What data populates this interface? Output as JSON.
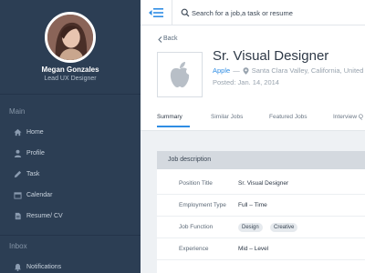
{
  "profile": {
    "name": "Megan Gonzales",
    "role": "Lead UX Designer"
  },
  "sidebar": {
    "main_label": "Main",
    "items": [
      {
        "label": "Home",
        "icon": "home-icon"
      },
      {
        "label": "Profile",
        "icon": "person-icon"
      },
      {
        "label": "Task",
        "icon": "pencil-icon"
      },
      {
        "label": "Calendar",
        "icon": "calendar-icon"
      },
      {
        "label": "Resume/ CV",
        "icon": "document-icon"
      }
    ],
    "inbox_label": "Inbox",
    "inbox_items": [
      {
        "label": "Notifications",
        "icon": "bell-icon"
      }
    ]
  },
  "search": {
    "placeholder": "Search for a job,a task or resume"
  },
  "job": {
    "back_label": "Back",
    "title": "Sr. Visual Designer",
    "company": "Apple",
    "dash": "—",
    "location": "Santa Clara Valley, California, United",
    "posted": "Posted: Jan. 14, 2014"
  },
  "tabs": [
    {
      "label": "Summary",
      "active": true
    },
    {
      "label": "Similar Jobs",
      "active": false
    },
    {
      "label": "Featured Jobs",
      "active": false
    },
    {
      "label": "Interview Q",
      "active": false
    }
  ],
  "description": {
    "title": "Job description",
    "rows": [
      {
        "label": "Position Title",
        "value": "Sr. Visual Designer"
      },
      {
        "label": "Employment Type",
        "value": "Full – Time"
      },
      {
        "label": "Job Function",
        "tags": [
          "Design",
          "Creative"
        ]
      },
      {
        "label": "Experience",
        "value": "Mid – Level"
      }
    ]
  },
  "colors": {
    "sidebar": "#2c3e54",
    "accent": "#2f8de4",
    "panel_header": "#d4d9df"
  }
}
